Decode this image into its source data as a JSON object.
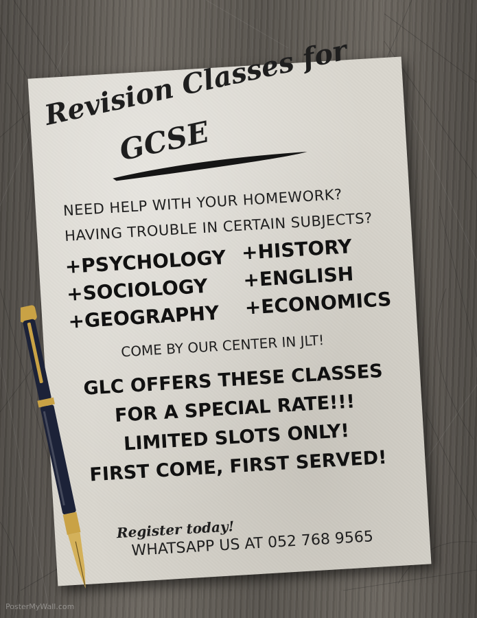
{
  "title": {
    "line1": "Revision Classes for",
    "line2": "GCSE"
  },
  "questions": [
    "NEED HELP WITH YOUR HOMEWORK?",
    "HAVING TROUBLE IN CERTAIN SUBJECTS?"
  ],
  "subjects": {
    "left": [
      "+PSYCHOLOGY",
      "+SOCIOLOGY",
      "+GEOGRAPHY"
    ],
    "right": [
      "+HISTORY",
      "+ENGLISH",
      "+ECONOMICS"
    ]
  },
  "center_text": "COME BY OUR CENTER IN JLT!",
  "offer_lines": [
    "GLC OFFERS THESE CLASSES",
    "FOR A SPECIAL RATE!!!",
    "LIMITED SLOTS ONLY!",
    "FIRST COME, FIRST SERVED!"
  ],
  "register_text": "Register today!",
  "whatsapp_text": "WHATSAPP US AT  052 768 9565",
  "watermark": "PosterMyWall.com",
  "colors": {
    "paper": "#d9d6ce",
    "ink": "#111111",
    "wood": "#5a5650",
    "pen_body": "#1c2238",
    "pen_gold": "#c9a245"
  },
  "icons": [
    "fountain-pen-icon"
  ]
}
